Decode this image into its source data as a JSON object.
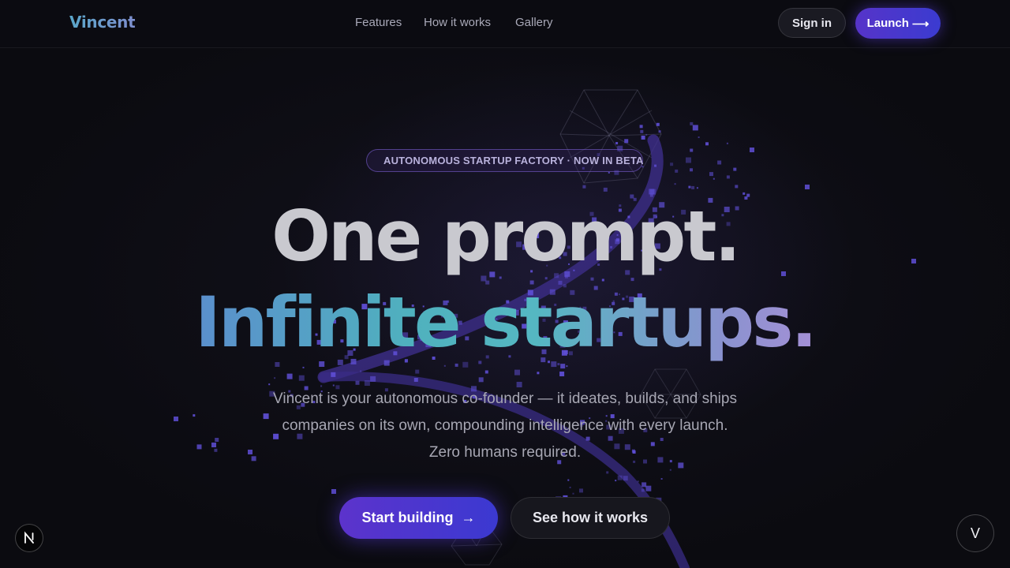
{
  "nav": {
    "logo": "Vincent",
    "links": [
      "Features",
      "How it works",
      "Gallery"
    ],
    "sign_in": "Sign in",
    "launch": "Launch",
    "launch_arrow": "⟶"
  },
  "hero": {
    "badge": "AUTONOMOUS STARTUP FACTORY · NOW IN BETA",
    "headline_line1": "One prompt.",
    "headline_line2": "Infinite startups.",
    "subtitle_line1": "Vincent is your autonomous co-founder — it ideates, builds, and ships",
    "subtitle_line2": "companies on its own, compounding intelligence with every launch.",
    "subtitle_line3": "Zero humans required.",
    "primary_cta": "Start building",
    "primary_cta_arrow": "→",
    "secondary_cta": "See how it works"
  },
  "floating": {
    "left_badge": "N",
    "right_badge": "V"
  },
  "colors": {
    "background": "#0b0b10",
    "accent_purple": "#5634c9",
    "accent_blue": "#3b3bd0",
    "heading_gray": "#c9c9cf",
    "gradient_teal": "#4fb1be",
    "particle": "#5f4fd6"
  },
  "icons": {
    "launch_arrow": "long-arrow-right-icon",
    "start_arrow": "arrow-right-icon",
    "left_badge": "nextjs-logo-icon"
  }
}
